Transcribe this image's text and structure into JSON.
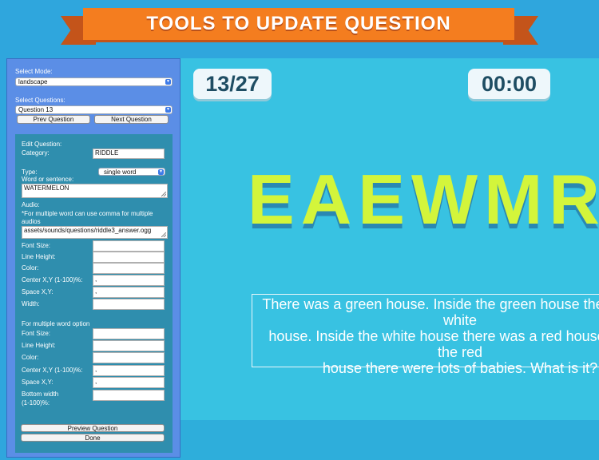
{
  "banner": {
    "title": "TOOLS TO UPDATE QUESTION"
  },
  "editor": {
    "mode_label": "Select Mode:",
    "mode_value": "landscape",
    "questions_label": "Select Questions:",
    "question_value": "Question 13",
    "prev_button": "Prev Question",
    "next_button": "Next Question",
    "edit_heading": "Edit Question:",
    "category_label": "Category:",
    "category_value": "RIDDLE",
    "type_label": "Type:",
    "type_value": "single word",
    "word_label": "Word or sentence:",
    "word_value": "WATERMELON",
    "audio_label": "Audio:",
    "audio_note_1": "*For multiple word can use comma for multiple",
    "audio_note_2": "audios",
    "audio_value": "assets/sounds/questions/riddle3_answer.ogg",
    "font_size_label": "Font Size:",
    "line_height_label": "Line Height:",
    "color_label": "Color:",
    "center_label": "Center X,Y (1-100)%:",
    "center_value": ",",
    "space_label": "Space X,Y:",
    "space_value": ",",
    "width_label": "Width:",
    "multi_heading": "For multiple word option",
    "m_font_size_label": "Font Size:",
    "m_line_height_label": "Line Height:",
    "m_color_label": "Color:",
    "m_center_label": "Center X,Y (1-100)%:",
    "m_center_value": ",",
    "m_space_label": "Space X,Y:",
    "m_space_value": ",",
    "bottom_width_label_1": "Bottom width",
    "bottom_width_label_2": "(1-100)%:",
    "preview_button": "Preview Question",
    "done_button": "Done"
  },
  "game": {
    "counter": "13/27",
    "timer": "00:00",
    "scrambled_word": "EAEWMRO",
    "sentence_1": "There was a green house. Inside the green house there was a white",
    "sentence_2": "house. Inside the white house there was a red house. Inside the red",
    "sentence_3": "house there were lots of babies. What is it?"
  },
  "colors": {
    "banner": "#f47d1f",
    "panel": "#5b8ee6",
    "panel_inner": "#2f8eae",
    "stage": "#38c2e2",
    "word": "#d3f53b"
  },
  "icons": {
    "dropdown": "chevron-down-icon"
  }
}
